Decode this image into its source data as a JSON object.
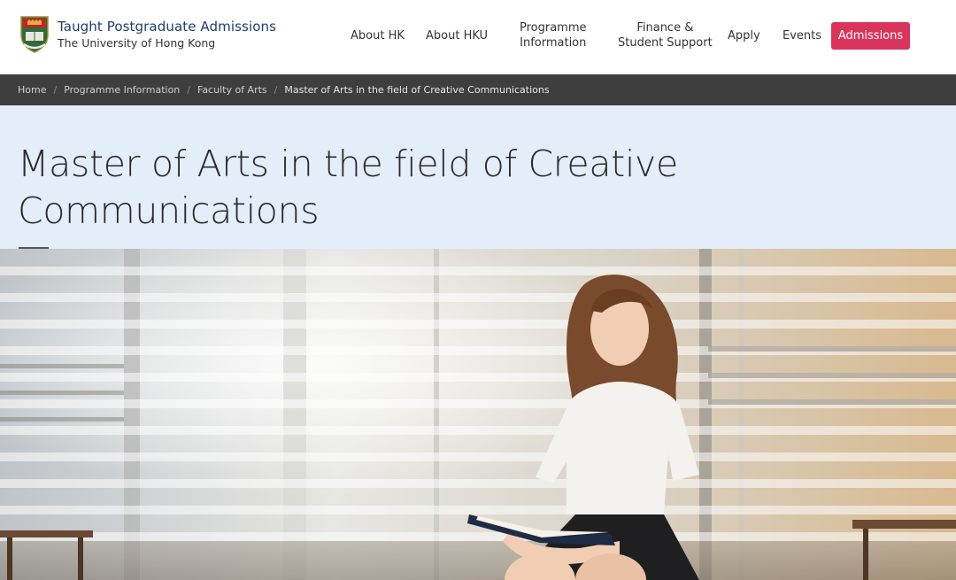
{
  "brand": {
    "title": "Taught Postgraduate Admissions",
    "subtitle": "The University of Hong Kong"
  },
  "nav": {
    "items": [
      {
        "label": "About HK"
      },
      {
        "label": "About HKU"
      },
      {
        "label_line1": "Programme",
        "label_line2": "Information"
      },
      {
        "label_line1": "Finance &",
        "label_line2": "Student Support"
      },
      {
        "label": "Apply"
      },
      {
        "label": "Events"
      }
    ],
    "cta_label": "Admissions"
  },
  "breadcrumb": {
    "items": [
      "Home",
      "Programme Information",
      "Faculty of Arts"
    ],
    "current": "Master of Arts in the field of Creative Communications",
    "separator": "/"
  },
  "page": {
    "title": "Master of Arts in the field of Creative Communications"
  },
  "hero": {
    "image": "woman-with-book-in-office-photo"
  },
  "colors": {
    "accent": "#d9355c",
    "brand": "#1f3d6b",
    "breadcrumb_bg": "#3e3e3e",
    "title_band": "#e4eefa"
  }
}
